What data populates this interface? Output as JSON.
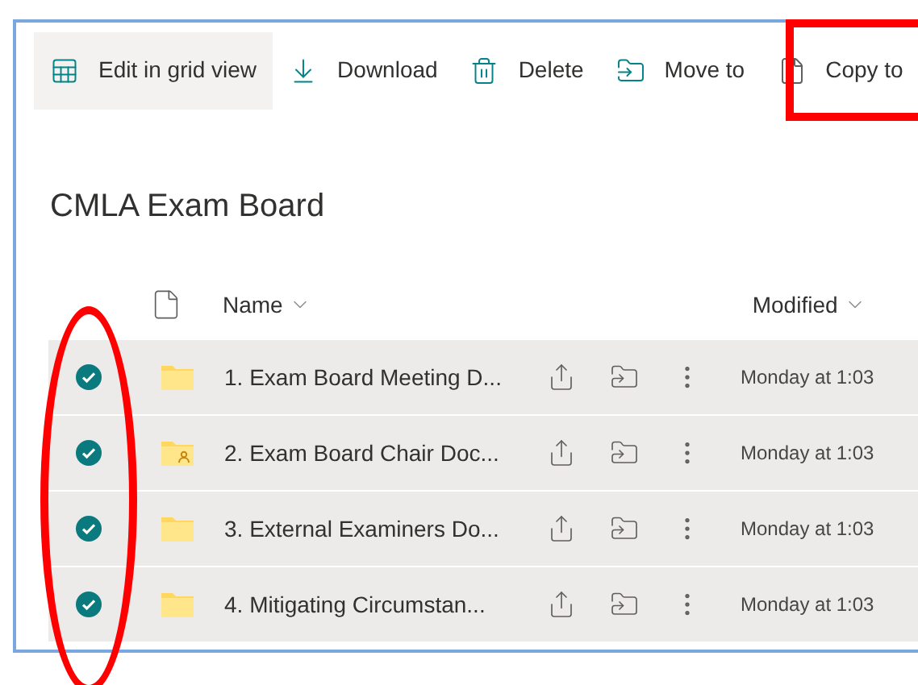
{
  "toolbar": [
    {
      "label": "Edit in grid view",
      "kind": "grid",
      "selected": true
    },
    {
      "label": "Download",
      "kind": "download",
      "selected": false
    },
    {
      "label": "Delete",
      "kind": "delete",
      "selected": false
    },
    {
      "label": "Move to",
      "kind": "move",
      "selected": false
    },
    {
      "label": "Copy to",
      "kind": "copy",
      "selected": false
    }
  ],
  "library": {
    "title": "CMLA Exam Board"
  },
  "table": {
    "columns": [
      "Name",
      "Modified"
    ],
    "rows": [
      {
        "name": "1. Exam Board Meeting D...",
        "kind": "folder",
        "modified": "Monday at 1:03",
        "selected": true
      },
      {
        "name": "2. Exam Board Chair Doc...",
        "kind": "shared_folder",
        "modified": "Monday at 1:03",
        "selected": true
      },
      {
        "name": "3. External Examiners Do...",
        "kind": "folder",
        "modified": "Monday at 1:03",
        "selected": true
      },
      {
        "name": "4. Mitigating Circumstan...",
        "kind": "folder",
        "modified": "Monday at 1:03",
        "selected": true
      }
    ]
  }
}
